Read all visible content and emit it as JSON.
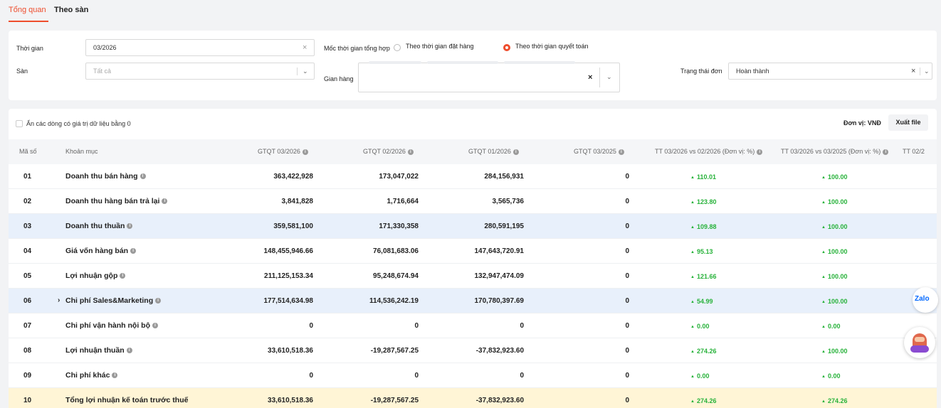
{
  "tabs": [
    {
      "label": "Tổng quan",
      "active": true
    },
    {
      "label": "Theo sàn",
      "active": false
    }
  ],
  "filters": {
    "time_label": "Thời gian",
    "time_value": "03/2026",
    "milestone_label": "Mốc thời gian tổng hợp",
    "radio_order_label": "Theo thời gian đặt hàng",
    "radio_settle_label": "Theo thời gian quyết toán",
    "radio_selected": "settle",
    "platform_label": "Sàn",
    "platform_placeholder": "Tất cả",
    "shop_label": "Gian hàng",
    "status_label": "Trạng thái đơn",
    "status_value": "Hoàn thành"
  },
  "toolbar": {
    "hide_zero_label": "Ẩn các dòng có giá trị dữ liệu bằng 0",
    "unit_label": "Đơn vị: VNĐ",
    "export_label": "Xuất file"
  },
  "table": {
    "headers": {
      "code": "Mã số",
      "item": "Khoản mục",
      "gtqt_0326": "GTQT 03/2026",
      "gtqt_0226": "GTQT 02/2026",
      "gtqt_0126": "GTQT 01/2026",
      "gtqt_0325": "GTQT 03/2025",
      "tt_mom": "TT 03/2026 vs 02/2026 (Đơn vị: %)",
      "tt_yoy": "TT 03/2026 vs 03/2025 (Đơn vị: %)",
      "tt_cut": "TT 02/2"
    },
    "rows": [
      {
        "code": "01",
        "item": "Doanh thu bán hàng",
        "info": true,
        "c1": "363,422,928",
        "c2": "173,047,022",
        "c3": "284,156,931",
        "c4": "0",
        "mom": "110.01",
        "yoy": "100.00",
        "style": "plain"
      },
      {
        "code": "02",
        "item": "Doanh thu hàng bán trả lại",
        "info": true,
        "c1": "3,841,828",
        "c2": "1,716,664",
        "c3": "3,565,736",
        "c4": "0",
        "mom": "123.80",
        "yoy": "100.00",
        "style": "plain"
      },
      {
        "code": "03",
        "item": "Doanh thu thuần",
        "info": true,
        "c1": "359,581,100",
        "c2": "171,330,358",
        "c3": "280,591,195",
        "c4": "0",
        "mom": "109.88",
        "yoy": "100.00",
        "style": "blue"
      },
      {
        "code": "04",
        "item": "Giá vốn hàng bán",
        "info": true,
        "c1": "148,455,946.66",
        "c2": "76,081,683.06",
        "c3": "147,643,720.91",
        "c4": "0",
        "mom": "95.13",
        "yoy": "100.00",
        "style": "plain"
      },
      {
        "code": "05",
        "item": "Lợi nhuận gộp",
        "info": true,
        "c1": "211,125,153.34",
        "c2": "95,248,674.94",
        "c3": "132,947,474.09",
        "c4": "0",
        "mom": "121.66",
        "yoy": "100.00",
        "style": "plain"
      },
      {
        "code": "06",
        "item": "Chi phí Sales&Marketing",
        "info": true,
        "expandable": true,
        "c1": "177,514,634.98",
        "c2": "114,536,242.19",
        "c3": "170,780,397.69",
        "c4": "0",
        "mom": "54.99",
        "yoy": "100.00",
        "style": "blue"
      },
      {
        "code": "07",
        "item": "Chi phí vận hành nội bộ",
        "info": true,
        "c1": "0",
        "c2": "0",
        "c3": "0",
        "c4": "0",
        "mom": "0.00",
        "yoy": "0.00",
        "style": "plain"
      },
      {
        "code": "08",
        "item": "Lợi nhuận thuần",
        "info": true,
        "c1": "33,610,518.36",
        "c2": "-19,287,567.25",
        "c3": "-37,832,923.60",
        "c4": "0",
        "mom": "274.26",
        "yoy": "100.00",
        "style": "plain"
      },
      {
        "code": "09",
        "item": "Chi phí khác",
        "info": true,
        "c1": "0",
        "c2": "0",
        "c3": "0",
        "c4": "0",
        "mom": "0.00",
        "yoy": "0.00",
        "style": "plain"
      },
      {
        "code": "10",
        "item": "Tổng lợi nhuận kế toán trước thuế",
        "info": false,
        "c1": "33,610,518.36",
        "c2": "-19,287,567.25",
        "c3": "-37,832,923.60",
        "c4": "0",
        "mom": "274.26",
        "yoy": "274.26",
        "style": "yellow"
      }
    ]
  },
  "widgets": {
    "zalo_label": "Zalo"
  },
  "colors": {
    "accent": "#ee4d2d",
    "positive": "#27b23a",
    "highlight_blue": "#e8f0fb",
    "highlight_yellow": "#fff5d6"
  },
  "icons": [
    "close-icon",
    "chevron-down-icon",
    "info-icon",
    "caret-up-icon",
    "chevron-right-icon",
    "checkbox-icon",
    "radio-icon",
    "zalo-icon",
    "chatbot-icon"
  ]
}
